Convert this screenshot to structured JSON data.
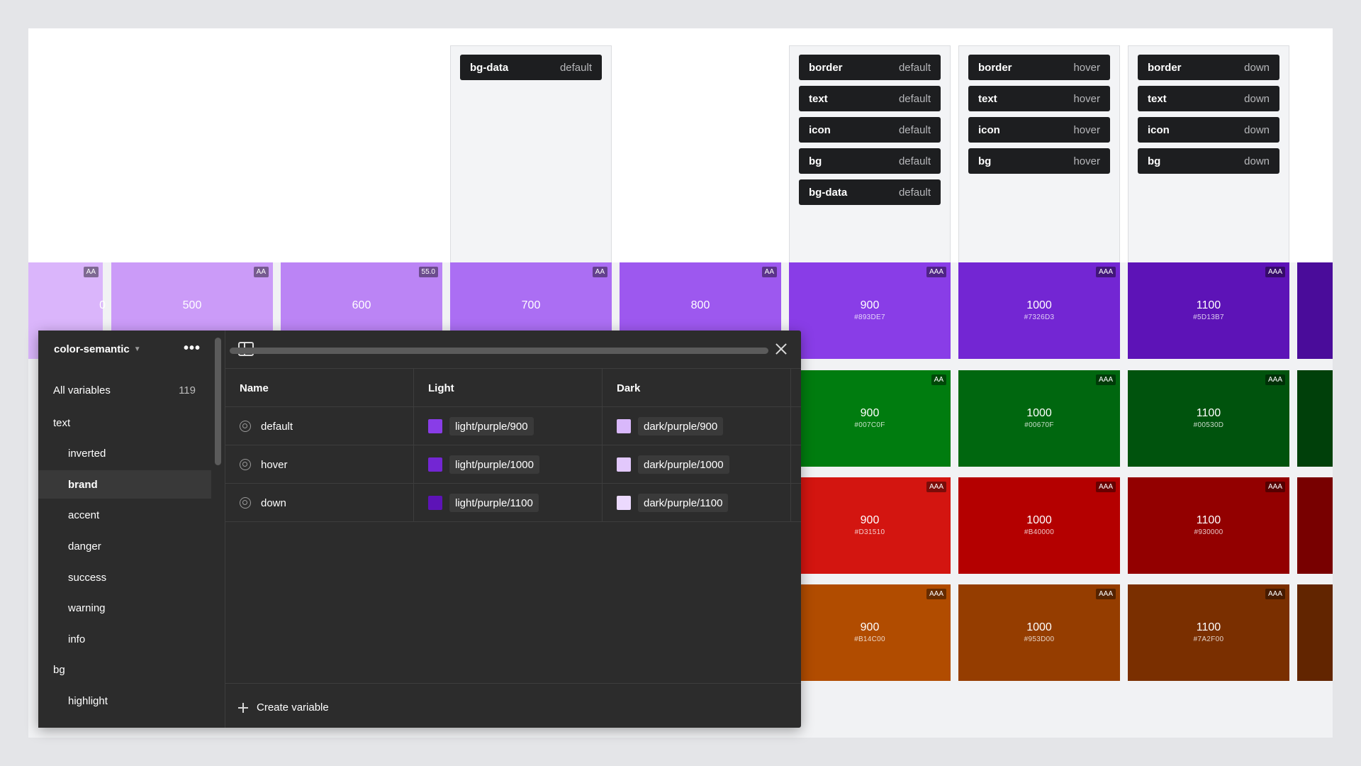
{
  "canvas": {
    "frames": [
      {
        "id": "700",
        "tokens": [
          {
            "name": "bg-data",
            "state": "default"
          }
        ]
      },
      {
        "id": "900",
        "tokens": [
          {
            "name": "border",
            "state": "default"
          },
          {
            "name": "text",
            "state": "default"
          },
          {
            "name": "icon",
            "state": "default"
          },
          {
            "name": "bg",
            "state": "default"
          },
          {
            "name": "bg-data",
            "state": "default"
          }
        ]
      },
      {
        "id": "1000",
        "tokens": [
          {
            "name": "border",
            "state": "hover"
          },
          {
            "name": "text",
            "state": "hover"
          },
          {
            "name": "icon",
            "state": "hover"
          },
          {
            "name": "bg",
            "state": "hover"
          }
        ]
      },
      {
        "id": "1100",
        "tokens": [
          {
            "name": "border",
            "state": "down"
          },
          {
            "name": "text",
            "state": "down"
          },
          {
            "name": "icon",
            "state": "down"
          },
          {
            "name": "bg",
            "state": "down"
          }
        ]
      }
    ],
    "purple_row": [
      {
        "step": "0",
        "badge": "AA",
        "hex": "",
        "color": "#dab5fb"
      },
      {
        "step": "500",
        "badge": "AA",
        "hex": "",
        "color": "#cb9bf8"
      },
      {
        "step": "600",
        "badge": "55.0",
        "hex": "",
        "color": "#bb84f5"
      },
      {
        "step": "700",
        "badge": "AA",
        "hex": "",
        "color": "#ab6ef3"
      },
      {
        "step": "800",
        "badge": "AA",
        "hex": "",
        "color": "#9d58ef"
      },
      {
        "step": "900",
        "badge": "AAA",
        "hex": "#893DE7",
        "color": "#893de7"
      },
      {
        "step": "1000",
        "badge": "AAA",
        "hex": "#7326D3",
        "color": "#7326d3"
      },
      {
        "step": "1100",
        "badge": "AAA",
        "hex": "#5D13B7",
        "color": "#5d13b7"
      },
      {
        "step": "",
        "badge": "",
        "hex": "",
        "color": "#4a0c9a"
      }
    ],
    "green_row": [
      {
        "step": "900",
        "badge": "AA",
        "hex": "#007C0F",
        "color": "#007c0f"
      },
      {
        "step": "1000",
        "badge": "AAA",
        "hex": "#00670F",
        "color": "#00670f"
      },
      {
        "step": "1100",
        "badge": "AAA",
        "hex": "#00530D",
        "color": "#00530d"
      },
      {
        "step": "",
        "badge": "",
        "hex": "",
        "color": "#00400a"
      }
    ],
    "red_row": [
      {
        "step": "900",
        "badge": "AAA",
        "hex": "#D31510",
        "color": "#d31510"
      },
      {
        "step": "1000",
        "badge": "AAA",
        "hex": "#B40000",
        "color": "#b40000"
      },
      {
        "step": "1100",
        "badge": "AAA",
        "hex": "#930000",
        "color": "#930000"
      },
      {
        "step": "",
        "badge": "",
        "hex": "",
        "color": "#780000"
      }
    ],
    "orange_row": [
      {
        "step": "900",
        "badge": "AAA",
        "hex": "#B14C00",
        "color": "#b14c00"
      },
      {
        "step": "1000",
        "badge": "AAA",
        "hex": "#953D00",
        "color": "#953d00"
      },
      {
        "step": "1100",
        "badge": "AAA",
        "hex": "#7A2F00",
        "color": "#7a2f00"
      },
      {
        "step": "",
        "badge": "",
        "hex": "",
        "color": "#622500"
      }
    ]
  },
  "panel": {
    "collection_name": "color-semantic",
    "more_label": "•••",
    "all_variables_label": "All variables",
    "all_variables_count": "119",
    "groups": [
      {
        "label": "text",
        "level": 0,
        "active": false
      },
      {
        "label": "inverted",
        "level": 1,
        "active": false
      },
      {
        "label": "brand",
        "level": 1,
        "active": true
      },
      {
        "label": "accent",
        "level": 1,
        "active": false
      },
      {
        "label": "danger",
        "level": 1,
        "active": false
      },
      {
        "label": "success",
        "level": 1,
        "active": false
      },
      {
        "label": "warning",
        "level": 1,
        "active": false
      },
      {
        "label": "info",
        "level": 1,
        "active": false
      },
      {
        "label": "bg",
        "level": 0,
        "active": false
      },
      {
        "label": "highlight",
        "level": 1,
        "active": false
      }
    ],
    "table": {
      "headers": {
        "name": "Name",
        "light": "Light",
        "dark": "Dark"
      },
      "rows": [
        {
          "name": "default",
          "light": "light/purple/900",
          "light_color": "#893de7",
          "dark": "dark/purple/900",
          "dark_color": "#d9b8fb"
        },
        {
          "name": "hover",
          "light": "light/purple/1000",
          "light_color": "#7326d3",
          "dark": "dark/purple/1000",
          "dark_color": "#e2c8fc"
        },
        {
          "name": "down",
          "light": "light/purple/1100",
          "light_color": "#5d13b7",
          "dark": "dark/purple/1100",
          "dark_color": "#ebd9fd"
        }
      ]
    },
    "create_variable_label": "Create variable"
  }
}
